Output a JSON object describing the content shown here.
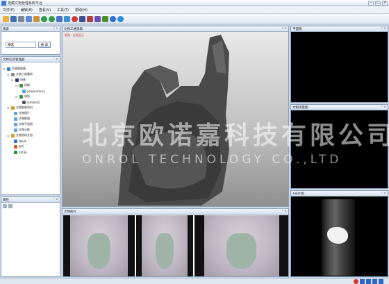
{
  "window": {
    "title": "馆藏文物管理系统平台"
  },
  "menu": [
    "文件(F)",
    "编辑(E)",
    "查看(V)",
    "工具(T)",
    "帮助(H)"
  ],
  "panels": {
    "search": {
      "title": "搜索",
      "input_value": "精选",
      "button": "搜 索"
    },
    "tree": {
      "title": "文物信息管理器",
      "nodes": [
        "资源管理器",
        "文物三维重构",
        "场景",
        "网格",
        "polySurface1",
        "材质",
        "lambert2",
        "文物图像资料",
        "文物照片",
        "文物影图",
        "文物平面图",
        "文物火影",
        "文物资料文档",
        "Word",
        "PPT",
        "EXCEL"
      ]
    },
    "props": {
      "title": "属性"
    },
    "view3d": {
      "title": "文物三维建模",
      "hint": "视角 · 光照显示"
    },
    "images": {
      "title": "文物图片"
    },
    "plane": {
      "title": "平面图"
    },
    "measure": {
      "title": "文物测量图"
    },
    "xray": {
      "title": "X光片图"
    }
  },
  "watermark": {
    "cn": "北京欧诺嘉科技有限公司",
    "en": "ONROL TECHNOLOGY CO.,LTD"
  },
  "colors": {
    "accent": "#3a7bd5",
    "panel_header": "#d4dfed",
    "frame": "#8aa0bb"
  },
  "icons": [
    "open-icon",
    "save-icon",
    "cut-icon",
    "copy-icon",
    "paste-icon",
    "undo-icon",
    "redo-icon",
    "arrow-icon",
    "move-icon",
    "rotate-icon",
    "zoom-icon",
    "shield-icon",
    "paint-icon",
    "grid-icon",
    "sphere-icon",
    "light-icon"
  ]
}
